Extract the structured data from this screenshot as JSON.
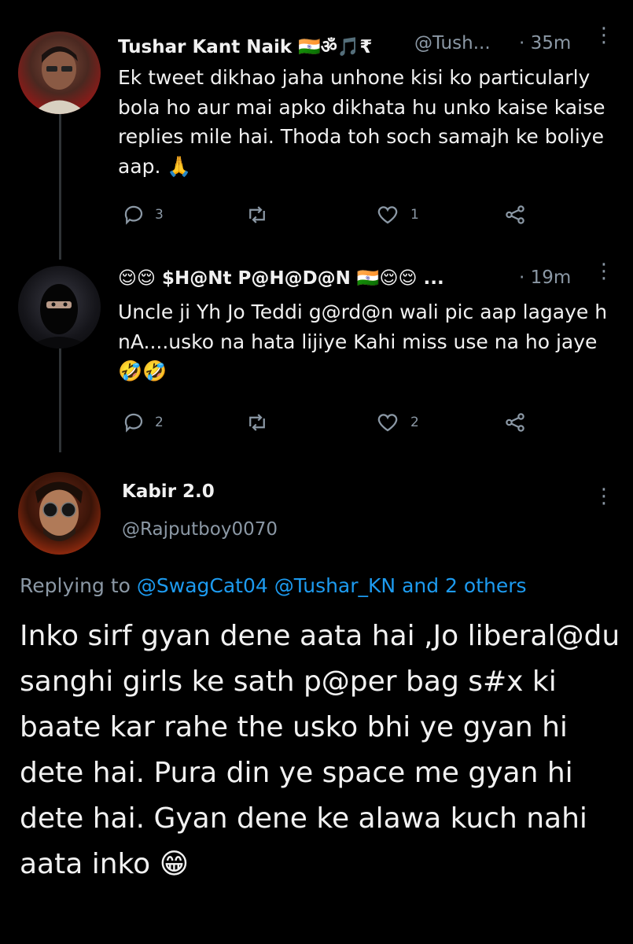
{
  "tweet1": {
    "name": "Tushar Kant Naik 🇮🇳ॐ🎵₹",
    "handle": "@Tush...",
    "time": "· 35m",
    "text": "Ek tweet dikhao jaha unhone kisi ko particularly bola ho aur mai apko dikhata hu unko kaise kaise replies mile hai. Thoda toh soch samajh ke boliye aap. 🙏",
    "replies": "3",
    "retweets": "",
    "likes": "1"
  },
  "tweet2": {
    "name": "😌😌 $H@Nt P@H@D@N 🇮🇳😌😌 ...",
    "time": "· 19m",
    "text": "Uncle ji Yh Jo Teddi g@rd@n wali pic aap lagaye h nA....usko na hata lijiye Kahi miss use na ho jaye🤣🤣",
    "replies": "2",
    "retweets": "",
    "likes": "2"
  },
  "main": {
    "name": "Kabir 2.0",
    "handle": "@Rajputboy0070",
    "replying_prefix": "Replying to",
    "replying_targets": "@SwagCat04 @Tushar_KN and 2 others",
    "text": "Inko sirf gyan dene aata hai ,Jo liberal@du sanghi girls ke sath p@per bag s#x ki baate kar rahe the usko bhi ye gyan hi dete hai. Pura din ye space me gyan hi dete hai. Gyan dene ke alawa kuch nahi aata inko 😁"
  },
  "icons": {
    "reply": "reply-icon",
    "retweet": "retweet-icon",
    "like": "heart-icon",
    "share": "share-icon",
    "more": "more-dots-icon"
  },
  "colors": {
    "background": "#000000",
    "text": "#f1f1f1",
    "muted": "#8b98a5",
    "link": "#1d9bf0"
  }
}
